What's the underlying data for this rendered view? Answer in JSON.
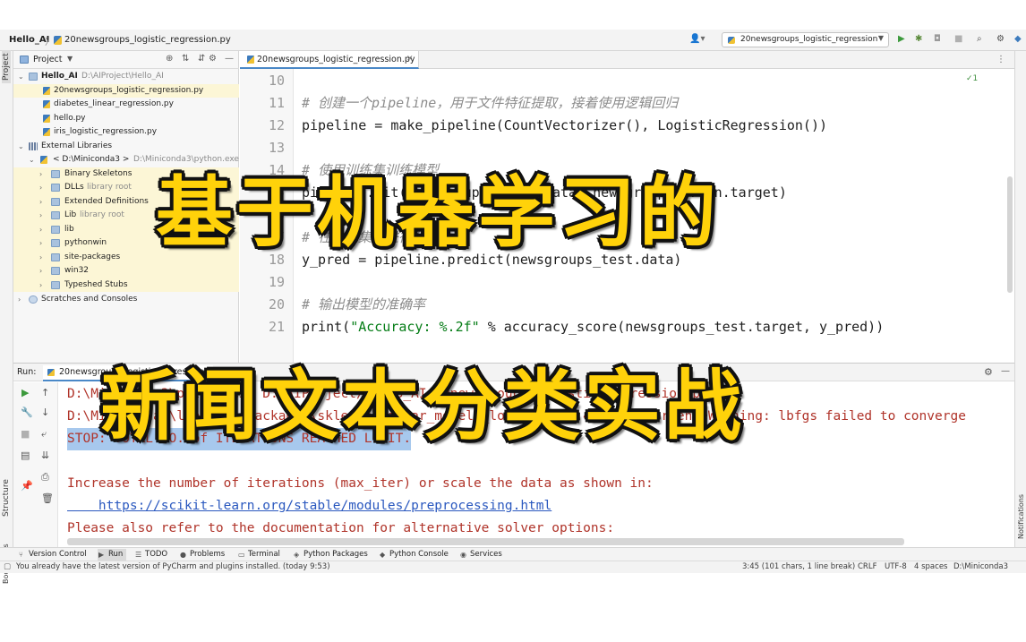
{
  "navbar": {
    "project": "Hello_AI",
    "separator": "〉",
    "file": "20newsgroups_logistic_regression.py",
    "run_config": "20newsgroups_logistic_regression",
    "icons": [
      "user-icon",
      "run-icon",
      "debug-icon",
      "coverage-icon",
      "stop-icon",
      "search-icon",
      "settings-icon"
    ]
  },
  "left_strip": {
    "project_label": "Project",
    "structure_label": "Structure",
    "bookmarks_label": "Bookmarks"
  },
  "right_strip": {
    "notifications_label": "Notifications"
  },
  "project_panel": {
    "title": "Project",
    "tree": [
      {
        "label": "Hello_AI",
        "path": "D:\\AIProject\\Hello_AI",
        "type": "folder",
        "expanded": true
      },
      {
        "label": "20newsgroups_logistic_regression.py",
        "type": "py",
        "selected": true
      },
      {
        "label": "diabetes_linear_regression.py",
        "type": "py"
      },
      {
        "label": "hello.py",
        "type": "py"
      },
      {
        "label": "iris_logistic_regression.py",
        "type": "py"
      },
      {
        "label": "External Libraries",
        "type": "lib",
        "expanded": true
      },
      {
        "label": "< D:\\Miniconda3 >",
        "path": "D:\\Miniconda3\\python.exe",
        "type": "python",
        "expanded": true
      },
      {
        "label": "Binary Skeletons",
        "type": "folder"
      },
      {
        "label": "DLLs",
        "path": "library root",
        "type": "folder"
      },
      {
        "label": "Extended Definitions",
        "type": "folder"
      },
      {
        "label": "Lib",
        "path": "library root",
        "type": "folder"
      },
      {
        "label": "lib",
        "type": "folder"
      },
      {
        "label": "pythonwin",
        "type": "folder"
      },
      {
        "label": "site-packages",
        "type": "folder"
      },
      {
        "label": "win32",
        "type": "folder"
      },
      {
        "label": "Typeshed Stubs",
        "type": "folder"
      },
      {
        "label": "Scratches and Consoles",
        "type": "scratch"
      }
    ]
  },
  "editor": {
    "tab_label": "20newsgroups_logistic_regression.py",
    "inspection": "✓1",
    "lines": [
      {
        "n": "10",
        "text": ""
      },
      {
        "n": "11",
        "text": "# 创建一个pipeline，用于文件特征提取，接着使用逻辑回归",
        "kind": "comment"
      },
      {
        "n": "12",
        "text": "pipeline = make_pipeline(CountVectorizer(), LogisticRegression())"
      },
      {
        "n": "13",
        "text": ""
      },
      {
        "n": "14",
        "text": "# 使用训练集训练模型",
        "kind": "comment"
      },
      {
        "n": "15",
        "text": "pipeline.fit(newsgroups_train.data, newsgroups_train.target)"
      },
      {
        "n": "16",
        "text": ""
      },
      {
        "n": "17",
        "text": "# 在测试集上进行预测",
        "kind": "comment"
      },
      {
        "n": "18",
        "text": "y_pred = pipeline.predict(newsgroups_test.data)"
      },
      {
        "n": "19",
        "text": ""
      },
      {
        "n": "20",
        "text": "# 输出模型的准确率",
        "kind": "comment"
      },
      {
        "n": "21",
        "text": "print(\"Accuracy: %.2f\" % accuracy_score(newsgroups_test.target, y_pred))"
      }
    ]
  },
  "run_panel": {
    "title": "Run:",
    "tab_label": "20newsgroups_logistic_regression",
    "console": [
      {
        "text": "D:\\Miniconda3\\python.exe D:/AIProject/Hello_AI/20newsgroups_logistic_regression.py"
      },
      {
        "text": "D:\\Miniconda3\\lib\\site-packages\\sklearn\\linear_model\\_logistic.py:458: ConvergenceWarning: lbfgs failed to converge"
      },
      {
        "text": "STOP: TOTAL NO. of ITERATIONS REACHED LIMIT.",
        "selected": true
      },
      {
        "text": ""
      },
      {
        "text": "Increase the number of iterations (max_iter) or scale the data as shown in:"
      },
      {
        "text": "    https://scikit-learn.org/stable/modules/preprocessing.html",
        "link": true
      },
      {
        "text": "Please also refer to the documentation for alternative solver options:"
      }
    ]
  },
  "tool_windows": [
    {
      "label": "Version Control",
      "icon": "branch-icon"
    },
    {
      "label": "Run",
      "icon": "run-icon",
      "active": true
    },
    {
      "label": "TODO",
      "icon": "list-icon"
    },
    {
      "label": "Problems",
      "icon": "problems-icon"
    },
    {
      "label": "Terminal",
      "icon": "terminal-icon"
    },
    {
      "label": "Python Packages",
      "icon": "packages-icon"
    },
    {
      "label": "Python Console",
      "icon": "python-icon"
    },
    {
      "label": "Services",
      "icon": "services-icon"
    }
  ],
  "statusbar": {
    "message": "You already have the latest version of PyCharm and plugins installed. (today 9:53)",
    "position": "3:45 (101 chars, 1 line break)",
    "line_sep": "CRLF",
    "encoding": "UTF-8",
    "indent": "4 spaces",
    "interpreter": "D:\\Miniconda3"
  },
  "overlay": {
    "line1": "基于机器学习的",
    "line2": "新闻文本分类实战",
    "fill_color": "#ffd20a",
    "outline_color": "#111111"
  }
}
